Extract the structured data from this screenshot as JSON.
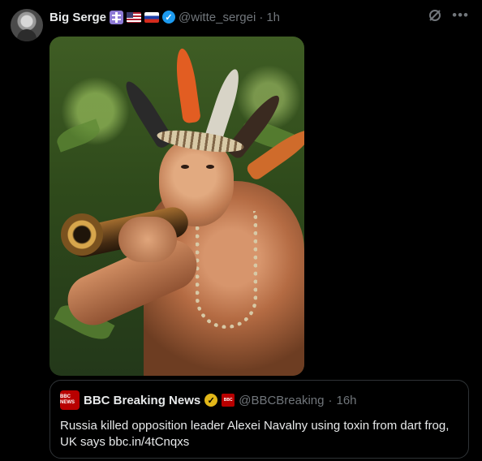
{
  "tweet": {
    "author_name": "Big Serge",
    "handle": "@witte_sergei",
    "separator": "·",
    "time": "1h",
    "icons": [
      "orthodox-cross-flag-icon",
      "us-flag-icon",
      "russia-flag-icon",
      "verified-badge-icon",
      "grok-icon",
      "more-icon"
    ]
  },
  "quoted_tweet": {
    "author_name": "BBC Breaking News",
    "handle": "@BBCBreaking",
    "separator": "·",
    "time": "16h",
    "text": "Russia killed opposition leader Alexei Navalny using toxin from dart frog, UK says bbc.in/4tCnqxs",
    "logo_text": "BBC NEWS"
  },
  "colors": {
    "background": "#000000",
    "primary_text": "#e7e9ea",
    "secondary_text": "#71767b",
    "verified_blue": "#1d9bf0",
    "verified_gold": "#e2b719",
    "bbc_red": "#b80000"
  }
}
